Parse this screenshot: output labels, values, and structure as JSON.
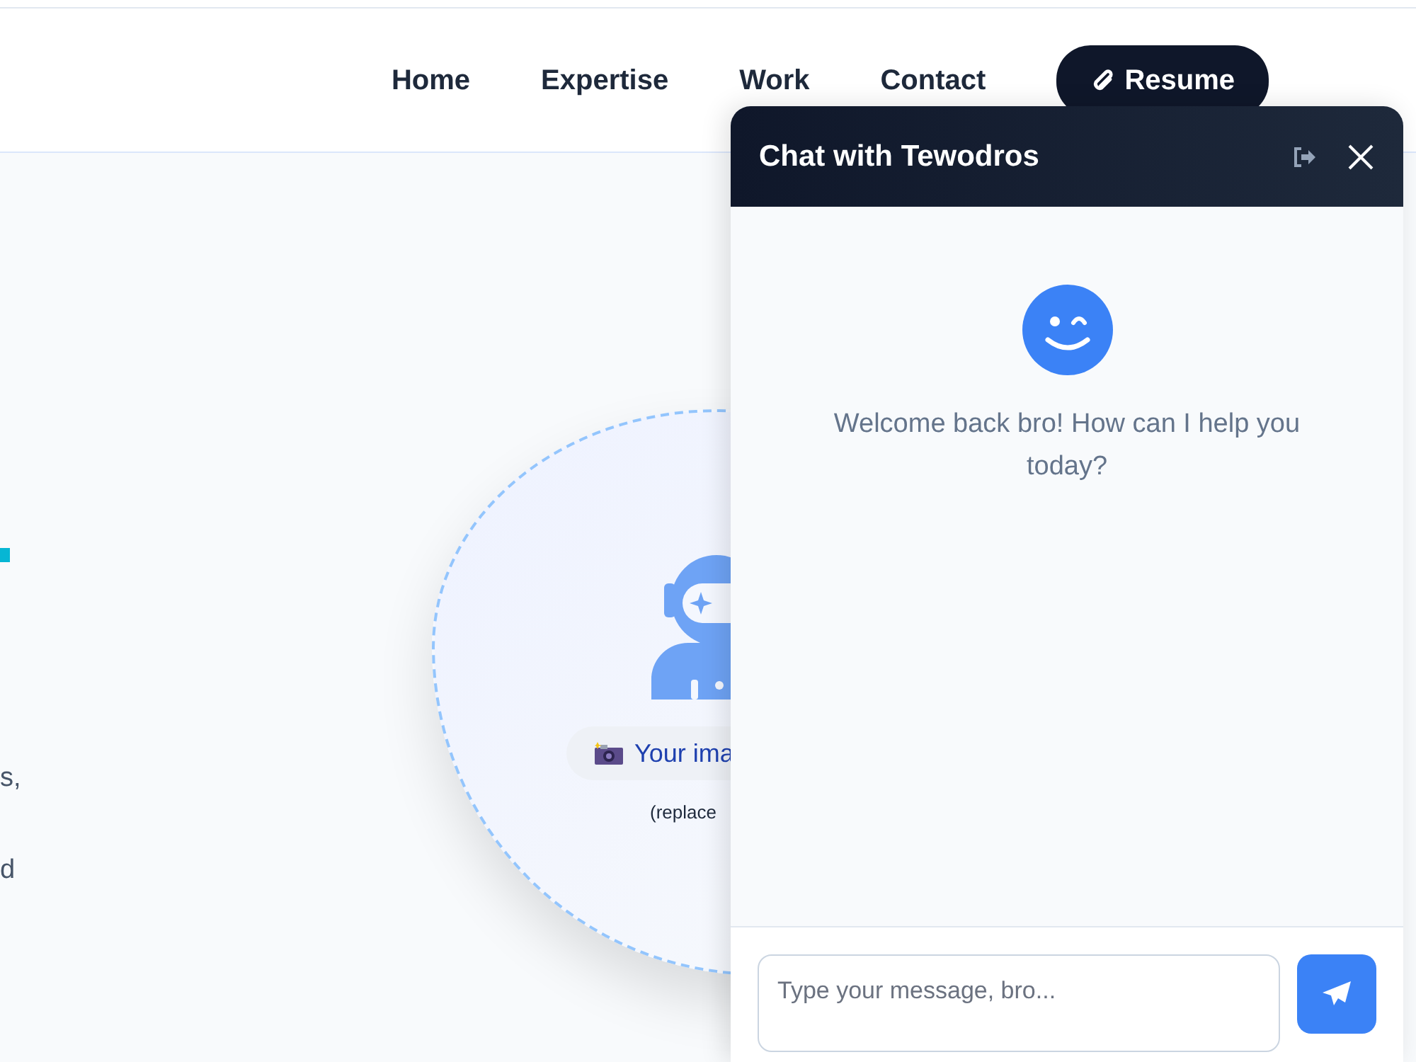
{
  "nav": {
    "links": [
      {
        "label": "Home"
      },
      {
        "label": "Expertise"
      },
      {
        "label": "Work"
      },
      {
        "label": "Contact"
      }
    ],
    "resume_button": "Resume"
  },
  "hero": {
    "text_fragments": [
      "s,",
      "d"
    ],
    "image_placeholder": {
      "label": "Your ima",
      "hint": "(replace"
    }
  },
  "chat": {
    "title": "Chat with Tewodros",
    "welcome": "Welcome back bro! How can I help you today?",
    "input": {
      "placeholder": "Type your message, bro..."
    }
  }
}
